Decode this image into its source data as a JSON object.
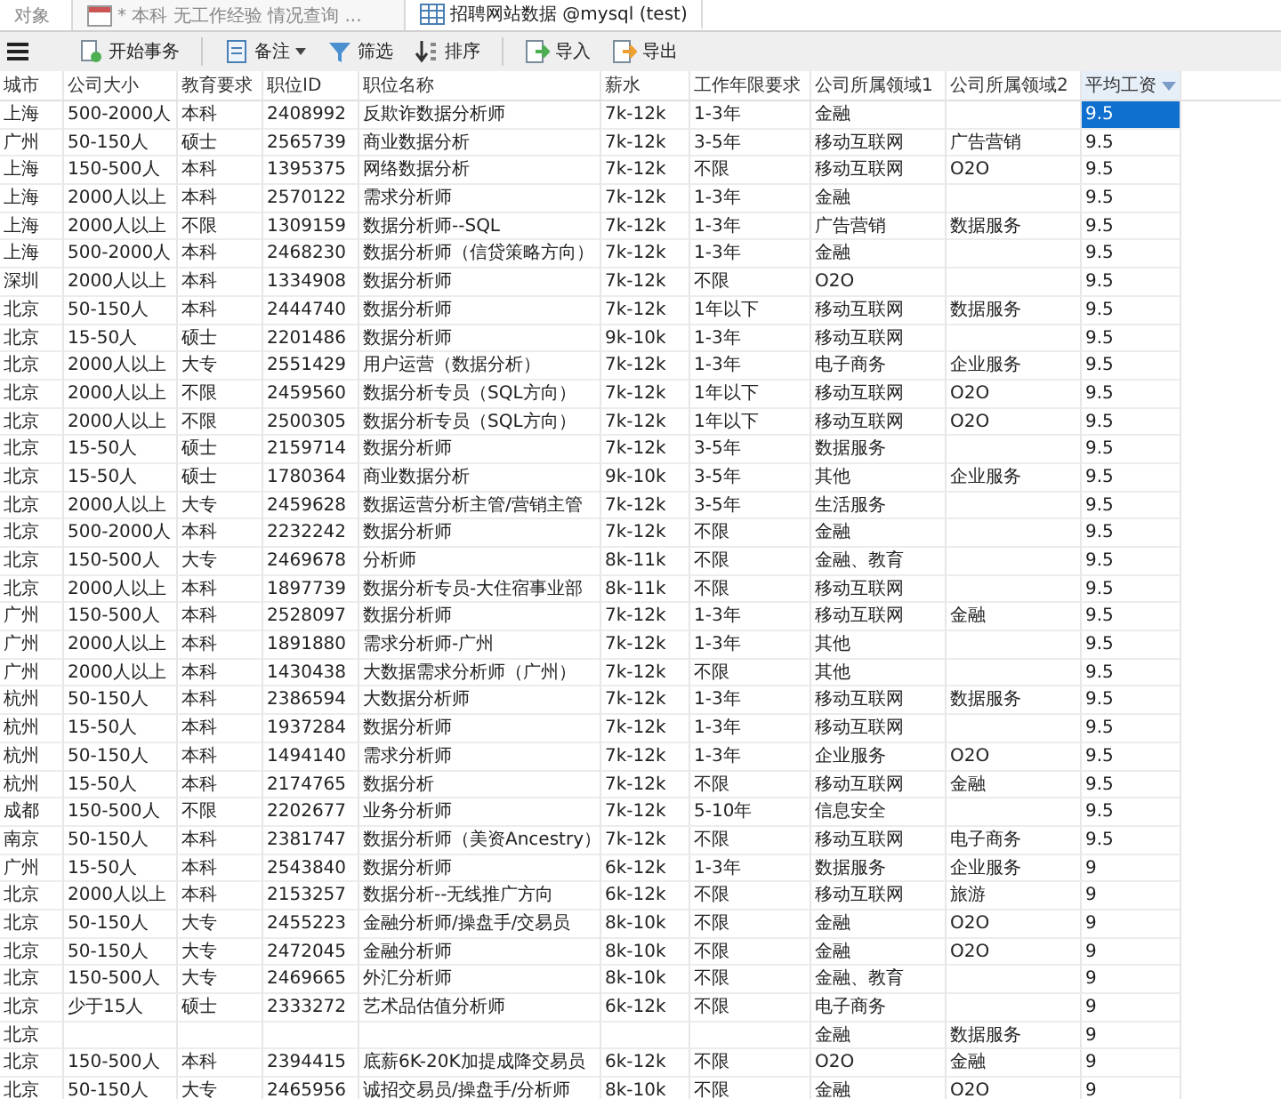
{
  "tabs": [
    {
      "label": "对象",
      "kind": "plain",
      "selected": false
    },
    {
      "label": "* 本科 无工作经验 情况查询 ...",
      "kind": "query",
      "selected": false
    },
    {
      "label": "招聘网站数据 @mysql (test)",
      "kind": "table",
      "selected": true
    }
  ],
  "toolbar": [
    {
      "kind": "menu"
    },
    {
      "kind": "transaction",
      "label": "开始事务"
    },
    {
      "kind": "note",
      "label": "备注"
    },
    {
      "kind": "filter",
      "label": "筛选"
    },
    {
      "kind": "sort",
      "label": "排序"
    },
    {
      "kind": "import",
      "label": "导入"
    },
    {
      "kind": "export",
      "label": "导出"
    }
  ],
  "table": {
    "columns": [
      {
        "label": "城市",
        "sorted": false
      },
      {
        "label": "公司大小",
        "sorted": false
      },
      {
        "label": "教育要求",
        "sorted": false
      },
      {
        "label": "职位ID",
        "sorted": false
      },
      {
        "label": "职位名称",
        "sorted": false
      },
      {
        "label": "薪水",
        "sorted": false
      },
      {
        "label": "工作年限要求",
        "sorted": false
      },
      {
        "label": "公司所属领域1",
        "sorted": false
      },
      {
        "label": "公司所属领域2",
        "sorted": false
      },
      {
        "label": "平均工资",
        "sorted": true
      }
    ],
    "rows": [
      {
        "selected": true,
        "cells": [
          "上海",
          "500-2000人",
          "本科",
          "2408992",
          "反欺诈数据分析师",
          "7k-12k",
          "1-3年",
          "金融",
          null,
          "9.5"
        ]
      },
      {
        "selected": false,
        "cells": [
          "广州",
          "50-150人",
          "硕士",
          "2565739",
          "商业数据分析",
          "7k-12k",
          "3-5年",
          "移动互联网",
          "广告营销",
          "9.5"
        ]
      },
      {
        "selected": false,
        "cells": [
          "上海",
          "150-500人",
          "本科",
          "1395375",
          "网络数据分析",
          "7k-12k",
          "不限",
          "移动互联网",
          "O2O",
          "9.5"
        ]
      },
      {
        "selected": false,
        "cells": [
          "上海",
          "2000人以上",
          "本科",
          "2570122",
          "需求分析师",
          "7k-12k",
          "1-3年",
          "金融",
          null,
          "9.5"
        ]
      },
      {
        "selected": false,
        "cells": [
          "上海",
          "2000人以上",
          "不限",
          "1309159",
          "数据分析师--SQL",
          "7k-12k",
          "1-3年",
          "广告营销",
          "数据服务",
          "9.5"
        ]
      },
      {
        "selected": false,
        "cells": [
          "上海",
          "500-2000人",
          "本科",
          "2468230",
          "数据分析师（信贷策略方向）",
          "7k-12k",
          "1-3年",
          "金融",
          null,
          "9.5"
        ]
      },
      {
        "selected": false,
        "cells": [
          "深圳",
          "2000人以上",
          "本科",
          "1334908",
          "数据分析师",
          "7k-12k",
          "不限",
          "O2O",
          null,
          "9.5"
        ]
      },
      {
        "selected": false,
        "cells": [
          "北京",
          "50-150人",
          "本科",
          "2444740",
          "数据分析师",
          "7k-12k",
          "1年以下",
          "移动互联网",
          "数据服务",
          "9.5"
        ]
      },
      {
        "selected": false,
        "cells": [
          "北京",
          "15-50人",
          "硕士",
          "2201486",
          "数据分析师",
          "9k-10k",
          "1-3年",
          "移动互联网",
          null,
          "9.5"
        ]
      },
      {
        "selected": false,
        "cells": [
          "北京",
          "2000人以上",
          "大专",
          "2551429",
          "用户运营（数据分析）",
          "7k-12k",
          "1-3年",
          "电子商务",
          "企业服务",
          "9.5"
        ]
      },
      {
        "selected": false,
        "cells": [
          "北京",
          "2000人以上",
          "不限",
          "2459560",
          "数据分析专员（SQL方向）",
          "7k-12k",
          "1年以下",
          "移动互联网",
          "O2O",
          "9.5"
        ]
      },
      {
        "selected": false,
        "cells": [
          "北京",
          "2000人以上",
          "不限",
          "2500305",
          "数据分析专员（SQL方向）",
          "7k-12k",
          "1年以下",
          "移动互联网",
          "O2O",
          "9.5"
        ]
      },
      {
        "selected": false,
        "cells": [
          "北京",
          "15-50人",
          "硕士",
          "2159714",
          "数据分析师",
          "7k-12k",
          "3-5年",
          "数据服务",
          null,
          "9.5"
        ]
      },
      {
        "selected": false,
        "cells": [
          "北京",
          "15-50人",
          "硕士",
          "1780364",
          "商业数据分析",
          "9k-10k",
          "3-5年",
          "其他",
          "企业服务",
          "9.5"
        ]
      },
      {
        "selected": false,
        "cells": [
          "北京",
          "2000人以上",
          "大专",
          "2459628",
          "数据运营分析主管/营销主管",
          "7k-12k",
          "3-5年",
          "生活服务",
          null,
          "9.5"
        ]
      },
      {
        "selected": false,
        "cells": [
          "北京",
          "500-2000人",
          "本科",
          "2232242",
          "数据分析师",
          "7k-12k",
          "不限",
          "金融",
          null,
          "9.5"
        ]
      },
      {
        "selected": false,
        "cells": [
          "北京",
          "150-500人",
          "大专",
          "2469678",
          "分析师",
          "8k-11k",
          "不限",
          "金融、教育",
          null,
          "9.5"
        ]
      },
      {
        "selected": false,
        "cells": [
          "北京",
          "2000人以上",
          "本科",
          "1897739",
          "数据分析专员-大住宿事业部",
          "8k-11k",
          "不限",
          "移动互联网",
          null,
          "9.5"
        ]
      },
      {
        "selected": false,
        "cells": [
          "广州",
          "150-500人",
          "本科",
          "2528097",
          "数据分析师",
          "7k-12k",
          "1-3年",
          "移动互联网",
          "金融",
          "9.5"
        ]
      },
      {
        "selected": false,
        "cells": [
          "广州",
          "2000人以上",
          "本科",
          "1891880",
          "需求分析师-广州",
          "7k-12k",
          "1-3年",
          "其他",
          null,
          "9.5"
        ]
      },
      {
        "selected": false,
        "cells": [
          "广州",
          "2000人以上",
          "本科",
          "1430438",
          "大数据需求分析师（广州）",
          "7k-12k",
          "不限",
          "其他",
          null,
          "9.5"
        ]
      },
      {
        "selected": false,
        "cells": [
          "杭州",
          "50-150人",
          "本科",
          "2386594",
          "大数据分析师",
          "7k-12k",
          "1-3年",
          "移动互联网",
          "数据服务",
          "9.5"
        ]
      },
      {
        "selected": false,
        "cells": [
          "杭州",
          "15-50人",
          "本科",
          "1937284",
          "数据分析师",
          "7k-12k",
          "1-3年",
          "移动互联网",
          null,
          "9.5"
        ]
      },
      {
        "selected": false,
        "cells": [
          "杭州",
          "50-150人",
          "本科",
          "1494140",
          "需求分析师",
          "7k-12k",
          "1-3年",
          "企业服务",
          "O2O",
          "9.5"
        ]
      },
      {
        "selected": false,
        "cells": [
          "杭州",
          "15-50人",
          "本科",
          "2174765",
          "数据分析",
          "7k-12k",
          "不限",
          "移动互联网",
          "金融",
          "9.5"
        ]
      },
      {
        "selected": false,
        "cells": [
          "成都",
          "150-500人",
          "不限",
          "2202677",
          "业务分析师",
          "7k-12k",
          "5-10年",
          "信息安全",
          null,
          "9.5"
        ]
      },
      {
        "selected": false,
        "cells": [
          "南京",
          "50-150人",
          "本科",
          "2381747",
          "数据分析师（美资Ancestry）",
          "7k-12k",
          "不限",
          "移动互联网",
          "电子商务",
          "9.5"
        ]
      },
      {
        "selected": false,
        "cells": [
          "广州",
          "15-50人",
          "本科",
          "2543840",
          "数据分析师",
          "6k-12k",
          "1-3年",
          "数据服务",
          "企业服务",
          "9"
        ]
      },
      {
        "selected": false,
        "cells": [
          "北京",
          "2000人以上",
          "本科",
          "2153257",
          "数据分析--无线推广方向",
          "6k-12k",
          "不限",
          "移动互联网",
          "旅游",
          "9"
        ]
      },
      {
        "selected": false,
        "cells": [
          "北京",
          "50-150人",
          "大专",
          "2455223",
          "金融分析师/操盘手/交易员",
          "8k-10k",
          "不限",
          "金融",
          "O2O",
          "9"
        ]
      },
      {
        "selected": false,
        "cells": [
          "北京",
          "50-150人",
          "大专",
          "2472045",
          "金融分析师",
          "8k-10k",
          "不限",
          "金融",
          "O2O",
          "9"
        ]
      },
      {
        "selected": false,
        "cells": [
          "北京",
          "150-500人",
          "大专",
          "2469665",
          "外汇分析师",
          "8k-10k",
          "不限",
          "金融、教育",
          null,
          "9"
        ]
      },
      {
        "selected": false,
        "cells": [
          "北京",
          "少于15人",
          "硕士",
          "2333272",
          "艺术品估值分析师",
          "6k-12k",
          "不限",
          "电子商务",
          null,
          "9"
        ]
      },
      {
        "selected": false,
        "cells": [
          "北京",
          null,
          null,
          null,
          null,
          null,
          null,
          "金融",
          "数据服务",
          "9"
        ]
      },
      {
        "selected": false,
        "cells": [
          "北京",
          "150-500人",
          "本科",
          "2394415",
          "底薪6K-20K加提成降交易员",
          "6k-12k",
          "不限",
          "O2O",
          "金融",
          "9"
        ]
      },
      {
        "selected": false,
        "cells": [
          "北京",
          "50-150人",
          "大专",
          "2465956",
          "诚招交易员/操盘手/分析师",
          "8k-10k",
          "不限",
          "金融",
          "O2O",
          "9"
        ]
      }
    ]
  }
}
